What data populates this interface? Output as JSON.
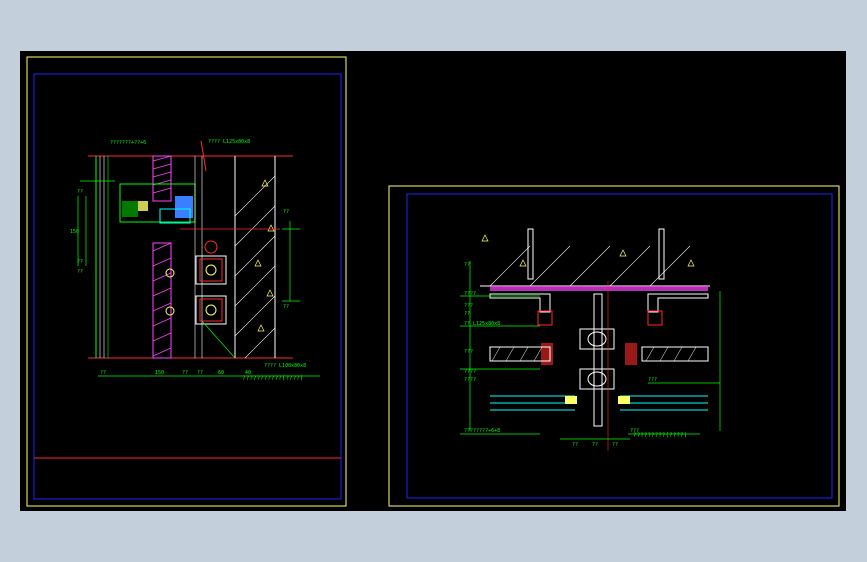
{
  "colors": {
    "background": "#000000",
    "viewport": "#c4cfdc",
    "frame": "#ffff66",
    "border": "#2222ff",
    "dim": "#00ff00",
    "section": "#ffffff",
    "accent_red": "#ff2a2a",
    "accent_magenta": "#ff44ff",
    "accent_cyan": "#00ffff"
  },
  "sheet_left": {
    "annot_top_1": "???????+??+6",
    "annot_top_2": "???? L125x80x8",
    "annot_right_1": "??",
    "annot_right_2": "??",
    "annot_bottom": "???? L100x80x8",
    "title": "???????????(????)",
    "dim_bottom": [
      "??",
      "150",
      "??",
      "??",
      "60",
      "40"
    ],
    "dim_left": [
      "??",
      "150",
      "??",
      "??"
    ]
  },
  "sheet_right": {
    "labels_left": [
      "??",
      "????",
      "???",
      "??",
      "?? L125x80x8",
      "???",
      "????",
      "????",
      "????????+6+8"
    ],
    "label_right_1": "???",
    "label_right_2": "???",
    "title": "?????????(????)",
    "dim_bottom": [
      "??",
      "??",
      "??"
    ]
  }
}
